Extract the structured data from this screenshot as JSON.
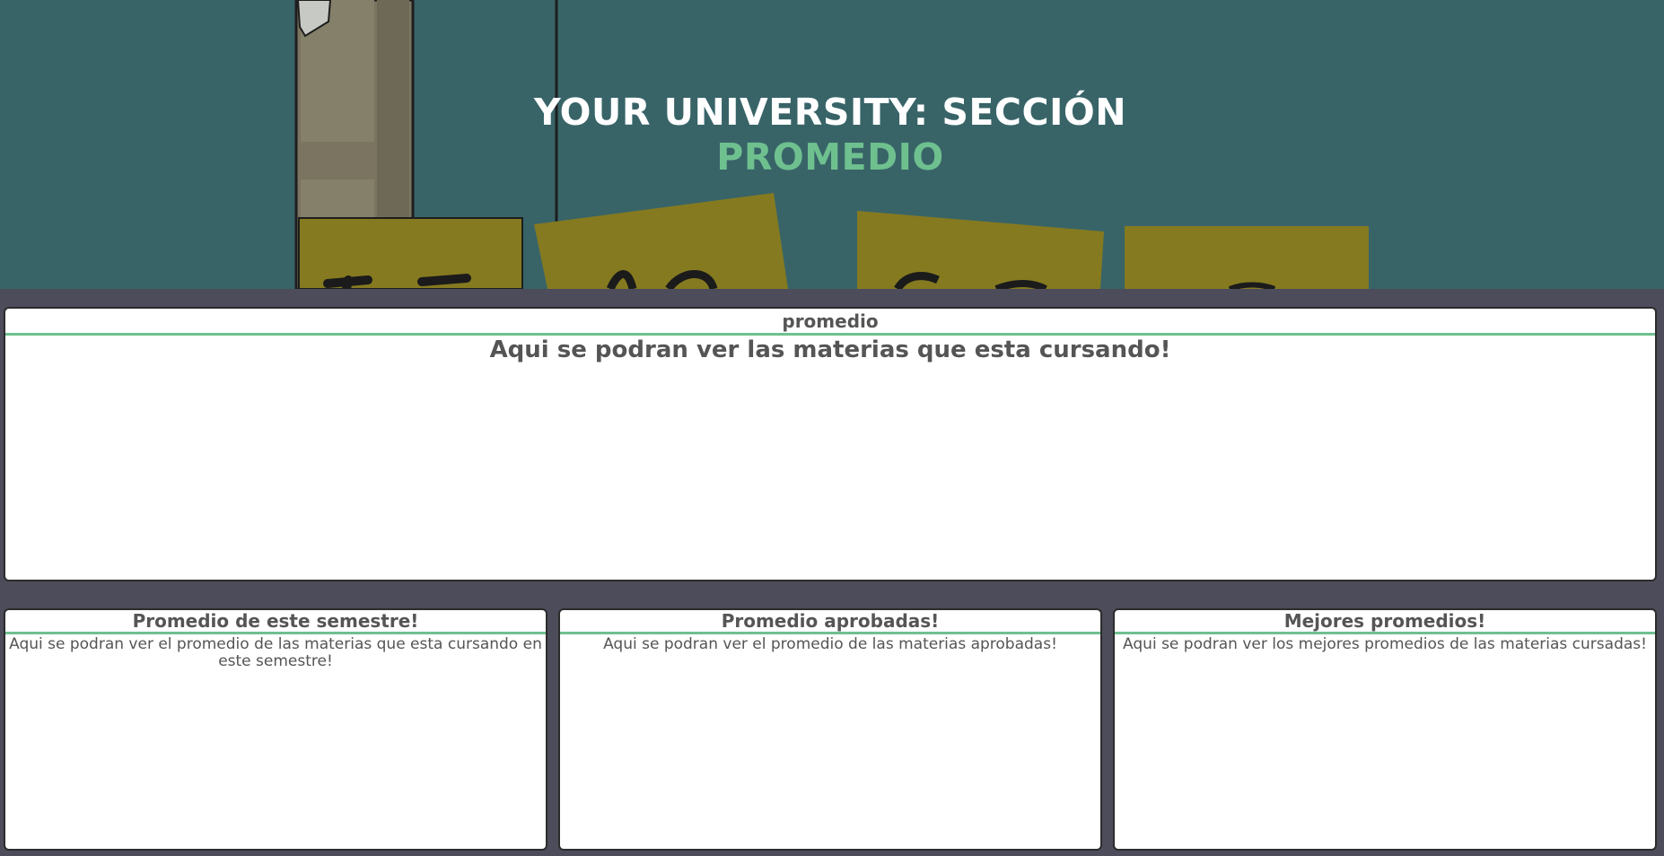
{
  "hero": {
    "title_line1": "YOUR UNIVERSITY: SECCIÓN",
    "title_line2": "PROMEDIO"
  },
  "main_panel": {
    "header": "promedio",
    "body": "Aqui se podran ver las materias que esta cursando!"
  },
  "cards": [
    {
      "header": "Promedio de este semestre!",
      "body": "Aqui se podran ver el promedio de las materias que esta cursando en este semestre!"
    },
    {
      "header": "Promedio aprobadas!",
      "body": "Aqui se podran ver el promedio de las materias aprobadas!"
    },
    {
      "header": "Mejores promedios!",
      "body": "Aqui se podran ver los mejores promedios de las materias cursadas!"
    }
  ],
  "colors": {
    "page_background": "#4d4c5a",
    "hero_background": "#386468",
    "accent_green": "#6fc08f",
    "text_gray": "#555555",
    "sign_yellow": "#8a7a1e"
  }
}
